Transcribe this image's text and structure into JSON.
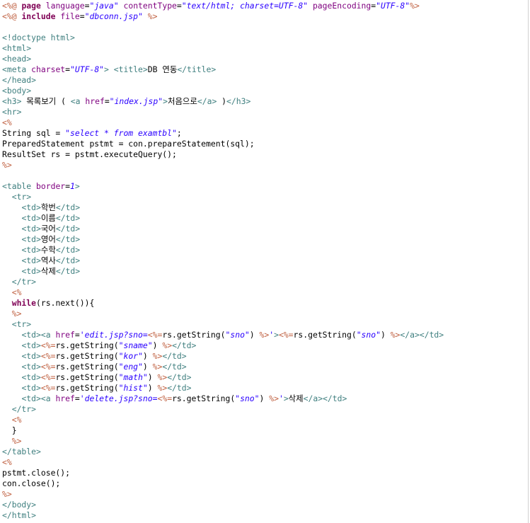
{
  "editor": {
    "colors": {
      "jsp_delim": "#bf5f3f",
      "tag": "#3f7f7f",
      "attr": "#7f007f",
      "value": "#2a00ff",
      "keyword": "#7f0055",
      "text": "#000000"
    },
    "lines": [
      [
        [
          "d",
          "<%@ "
        ],
        [
          "k",
          "page "
        ],
        [
          "a",
          "language"
        ],
        [
          "t",
          "="
        ],
        [
          "v",
          "\"java\""
        ],
        [
          "t",
          " "
        ],
        [
          "a",
          "contentType"
        ],
        [
          "t",
          "="
        ],
        [
          "v",
          "\"text/html; charset=UTF-8\""
        ],
        [
          "t",
          " "
        ],
        [
          "a",
          "pageEncoding"
        ],
        [
          "t",
          "="
        ],
        [
          "v",
          "\"UTF-8\""
        ],
        [
          "d",
          "%>"
        ]
      ],
      [
        [
          "d",
          "<%@ "
        ],
        [
          "k",
          "include "
        ],
        [
          "a",
          "file"
        ],
        [
          "t",
          "="
        ],
        [
          "v",
          "\"dbconn.jsp\""
        ],
        [
          "t",
          " "
        ],
        [
          "d",
          "%>"
        ]
      ],
      [],
      [
        [
          "g",
          "<!doctype html>"
        ]
      ],
      [
        [
          "g",
          "<html>"
        ]
      ],
      [
        [
          "g",
          "<head>"
        ]
      ],
      [
        [
          "g",
          "<meta "
        ],
        [
          "a",
          "charset"
        ],
        [
          "t",
          "="
        ],
        [
          "v",
          "\"UTF-8\""
        ],
        [
          "g",
          ">"
        ],
        [
          "t",
          " "
        ],
        [
          "g",
          "<title>"
        ],
        [
          "t",
          "DB 연동"
        ],
        [
          "g",
          "</title>"
        ]
      ],
      [
        [
          "g",
          "</head>"
        ]
      ],
      [
        [
          "g",
          "<body>"
        ]
      ],
      [
        [
          "g",
          "<h3>"
        ],
        [
          "t",
          " 목록보기 ( "
        ],
        [
          "g",
          "<a "
        ],
        [
          "a",
          "href"
        ],
        [
          "t",
          "="
        ],
        [
          "v",
          "\"index.jsp\""
        ],
        [
          "g",
          ">"
        ],
        [
          "t",
          "처음으로"
        ],
        [
          "g",
          "</a>"
        ],
        [
          "t",
          " )"
        ],
        [
          "g",
          "</h3>"
        ]
      ],
      [
        [
          "g",
          "<hr>"
        ]
      ],
      [
        [
          "d",
          "<%"
        ]
      ],
      [
        [
          "t",
          "String sql = "
        ],
        [
          "v",
          "\"select * from examtbl\""
        ],
        [
          "t",
          ";"
        ]
      ],
      [
        [
          "t",
          "PreparedStatement pstmt = con.prepareStatement(sql);"
        ]
      ],
      [
        [
          "t",
          "ResultSet rs = pstmt.executeQuery();"
        ]
      ],
      [
        [
          "d",
          "%>"
        ]
      ],
      [],
      [
        [
          "g",
          "<table "
        ],
        [
          "a",
          "border"
        ],
        [
          "t",
          "="
        ],
        [
          "v",
          "1"
        ],
        [
          "g",
          ">"
        ]
      ],
      [
        [
          "t",
          "  "
        ],
        [
          "g",
          "<tr>"
        ]
      ],
      [
        [
          "t",
          "    "
        ],
        [
          "g",
          "<td>"
        ],
        [
          "t",
          "학번"
        ],
        [
          "g",
          "</td>"
        ]
      ],
      [
        [
          "t",
          "    "
        ],
        [
          "g",
          "<td>"
        ],
        [
          "t",
          "이름"
        ],
        [
          "g",
          "</td>"
        ]
      ],
      [
        [
          "t",
          "    "
        ],
        [
          "g",
          "<td>"
        ],
        [
          "t",
          "국어"
        ],
        [
          "g",
          "</td>"
        ]
      ],
      [
        [
          "t",
          "    "
        ],
        [
          "g",
          "<td>"
        ],
        [
          "t",
          "영어"
        ],
        [
          "g",
          "</td>"
        ]
      ],
      [
        [
          "t",
          "    "
        ],
        [
          "g",
          "<td>"
        ],
        [
          "t",
          "수학"
        ],
        [
          "g",
          "</td>"
        ]
      ],
      [
        [
          "t",
          "    "
        ],
        [
          "g",
          "<td>"
        ],
        [
          "t",
          "역사"
        ],
        [
          "g",
          "</td>"
        ]
      ],
      [
        [
          "t",
          "    "
        ],
        [
          "g",
          "<td>"
        ],
        [
          "t",
          "삭제"
        ],
        [
          "g",
          "</td>"
        ]
      ],
      [
        [
          "t",
          "  "
        ],
        [
          "g",
          "</tr>"
        ]
      ],
      [
        [
          "t",
          "  "
        ],
        [
          "d",
          "<%"
        ]
      ],
      [
        [
          "t",
          "  "
        ],
        [
          "k",
          "while"
        ],
        [
          "t",
          "(rs.next()){"
        ]
      ],
      [
        [
          "t",
          "  "
        ],
        [
          "d",
          "%>"
        ]
      ],
      [
        [
          "t",
          "  "
        ],
        [
          "g",
          "<tr>"
        ]
      ],
      [
        [
          "t",
          "    "
        ],
        [
          "g",
          "<td><a "
        ],
        [
          "a",
          "href"
        ],
        [
          "t",
          "="
        ],
        [
          "v",
          "'edit.jsp?sno="
        ],
        [
          "d",
          "<%="
        ],
        [
          "t",
          "rs.getString("
        ],
        [
          "v",
          "\"sno\""
        ],
        [
          "t",
          ") "
        ],
        [
          "d",
          "%>"
        ],
        [
          "v",
          "'"
        ],
        [
          "g",
          ">"
        ],
        [
          "d",
          "<%="
        ],
        [
          "t",
          "rs.getString("
        ],
        [
          "v",
          "\"sno\""
        ],
        [
          "t",
          ") "
        ],
        [
          "d",
          "%>"
        ],
        [
          "g",
          "</a></td>"
        ]
      ],
      [
        [
          "t",
          "    "
        ],
        [
          "g",
          "<td>"
        ],
        [
          "d",
          "<%="
        ],
        [
          "t",
          "rs.getString("
        ],
        [
          "v",
          "\"sname\""
        ],
        [
          "t",
          ") "
        ],
        [
          "d",
          "%>"
        ],
        [
          "g",
          "</td>"
        ]
      ],
      [
        [
          "t",
          "    "
        ],
        [
          "g",
          "<td>"
        ],
        [
          "d",
          "<%="
        ],
        [
          "t",
          "rs.getString("
        ],
        [
          "v",
          "\"kor\""
        ],
        [
          "t",
          ") "
        ],
        [
          "d",
          "%>"
        ],
        [
          "g",
          "</td>"
        ]
      ],
      [
        [
          "t",
          "    "
        ],
        [
          "g",
          "<td>"
        ],
        [
          "d",
          "<%="
        ],
        [
          "t",
          "rs.getString("
        ],
        [
          "v",
          "\"eng\""
        ],
        [
          "t",
          ") "
        ],
        [
          "d",
          "%>"
        ],
        [
          "g",
          "</td>"
        ]
      ],
      [
        [
          "t",
          "    "
        ],
        [
          "g",
          "<td>"
        ],
        [
          "d",
          "<%="
        ],
        [
          "t",
          "rs.getString("
        ],
        [
          "v",
          "\"math\""
        ],
        [
          "t",
          ") "
        ],
        [
          "d",
          "%>"
        ],
        [
          "g",
          "</td>"
        ]
      ],
      [
        [
          "t",
          "    "
        ],
        [
          "g",
          "<td>"
        ],
        [
          "d",
          "<%="
        ],
        [
          "t",
          "rs.getString("
        ],
        [
          "v",
          "\"hist\""
        ],
        [
          "t",
          ") "
        ],
        [
          "d",
          "%>"
        ],
        [
          "g",
          "</td>"
        ]
      ],
      [
        [
          "t",
          "    "
        ],
        [
          "g",
          "<td><a "
        ],
        [
          "a",
          "href"
        ],
        [
          "t",
          "="
        ],
        [
          "v",
          "'delete.jsp?sno="
        ],
        [
          "d",
          "<%="
        ],
        [
          "t",
          "rs.getString("
        ],
        [
          "v",
          "\"sno\""
        ],
        [
          "t",
          ") "
        ],
        [
          "d",
          "%>"
        ],
        [
          "v",
          "'"
        ],
        [
          "g",
          ">"
        ],
        [
          "t",
          "삭제"
        ],
        [
          "g",
          "</a></td>"
        ]
      ],
      [
        [
          "t",
          "  "
        ],
        [
          "g",
          "</tr>"
        ]
      ],
      [
        [
          "t",
          "  "
        ],
        [
          "d",
          "<%"
        ]
      ],
      [
        [
          "t",
          "  }"
        ]
      ],
      [
        [
          "t",
          "  "
        ],
        [
          "d",
          "%>"
        ]
      ],
      [
        [
          "g",
          "</table>"
        ]
      ],
      [
        [
          "d",
          "<%"
        ]
      ],
      [
        [
          "t",
          "pstmt.close();"
        ]
      ],
      [
        [
          "t",
          "con.close();"
        ]
      ],
      [
        [
          "d",
          "%>"
        ]
      ],
      [
        [
          "g",
          "</body>"
        ]
      ],
      [
        [
          "g",
          "</html>"
        ]
      ]
    ]
  }
}
